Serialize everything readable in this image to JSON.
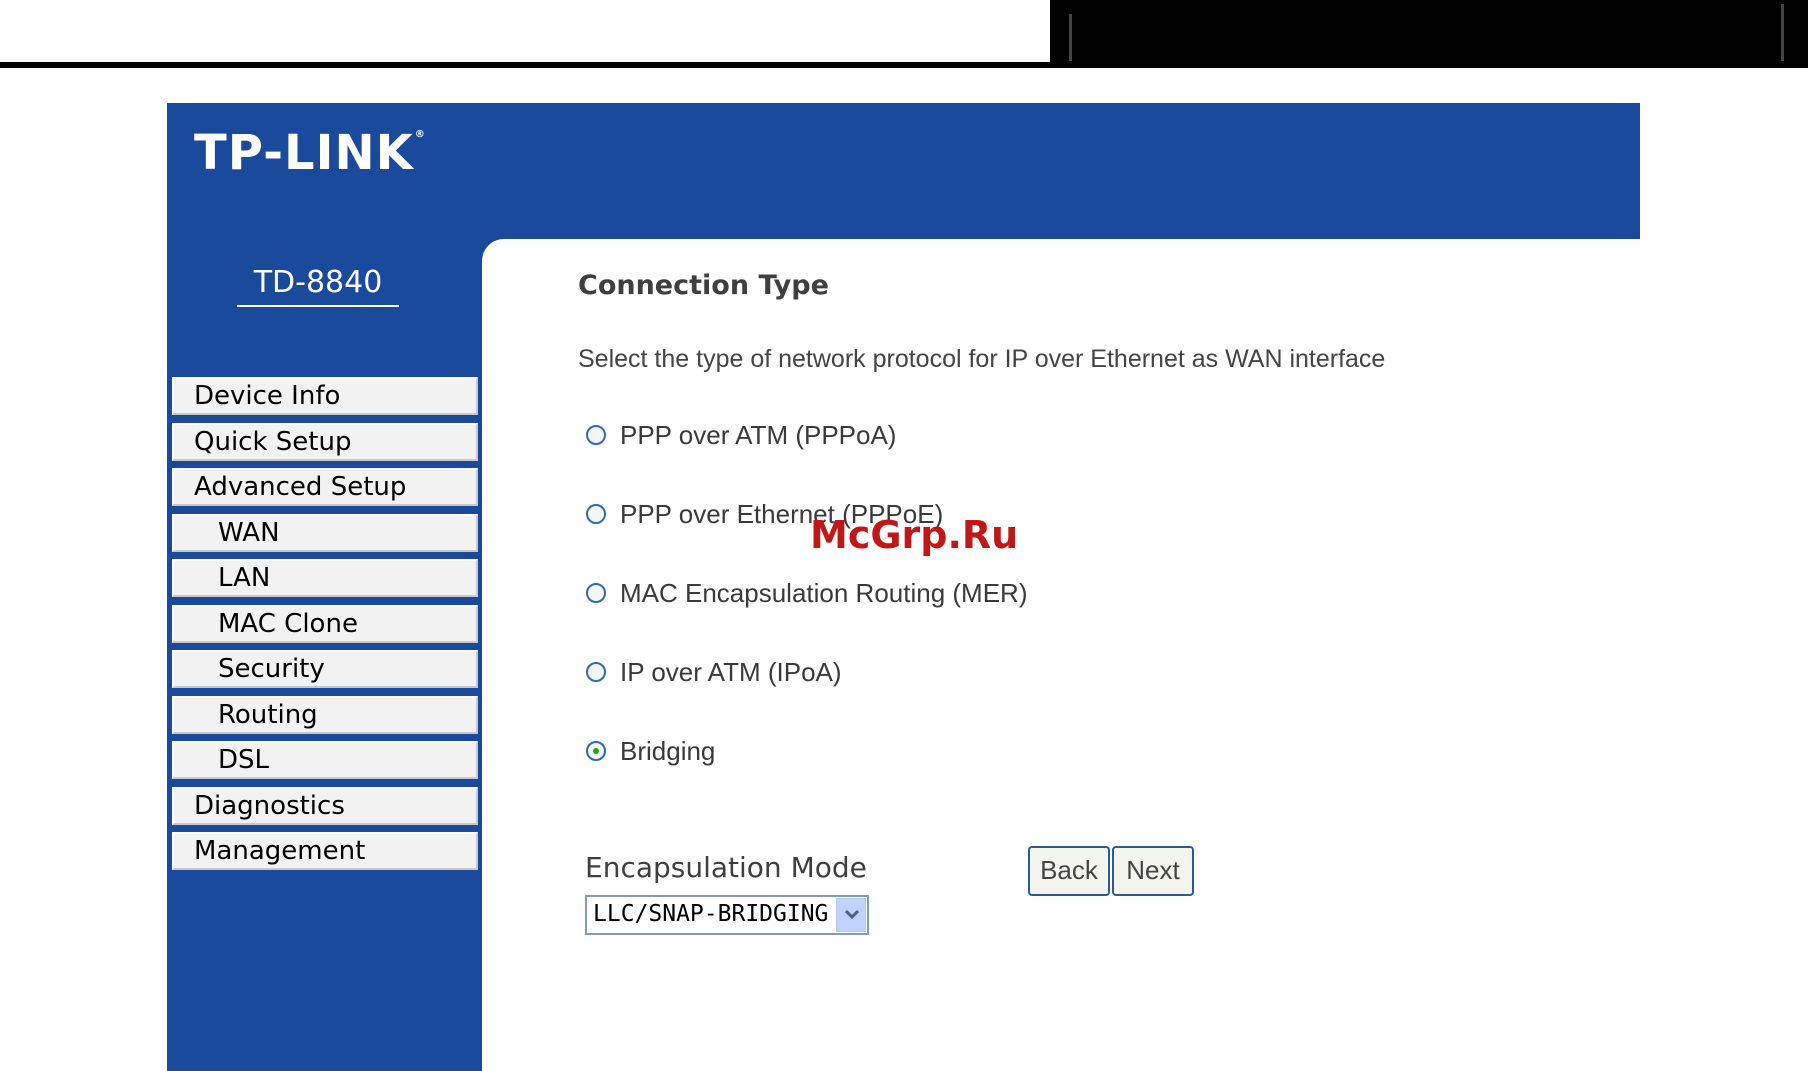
{
  "brand": {
    "logo_text": "TP-LINK",
    "trademark": "®"
  },
  "device": {
    "model": "TD-8840"
  },
  "nav": {
    "items": [
      {
        "label": "Device Info"
      },
      {
        "label": "Quick Setup"
      },
      {
        "label": "Advanced Setup"
      },
      {
        "label": "WAN"
      },
      {
        "label": "LAN"
      },
      {
        "label": "MAC Clone"
      },
      {
        "label": "Security"
      },
      {
        "label": "Routing"
      },
      {
        "label": "DSL"
      },
      {
        "label": "Diagnostics"
      },
      {
        "label": "Management"
      }
    ]
  },
  "main": {
    "title": "Connection Type",
    "description": "Select the type of network protocol for IP over Ethernet as WAN interface",
    "options": [
      {
        "label": "PPP over ATM (PPPoA)",
        "selected": false
      },
      {
        "label": "PPP over Ethernet (PPPoE)",
        "selected": false
      },
      {
        "label": "MAC Encapsulation Routing (MER)",
        "selected": false
      },
      {
        "label": "IP over ATM (IPoA)",
        "selected": false
      },
      {
        "label": "Bridging",
        "selected": true
      }
    ],
    "encapsulation": {
      "label": "Encapsulation Mode",
      "value": "LLC/SNAP-BRIDGING"
    },
    "buttons": {
      "back": "Back",
      "next": "Next"
    }
  },
  "watermark": "McGrp.Ru",
  "colors": {
    "frame_blue": "#1a4a9c",
    "nav_bg": "#f2f2f2",
    "radio_selected": "#21a121",
    "watermark": "#c01818"
  }
}
